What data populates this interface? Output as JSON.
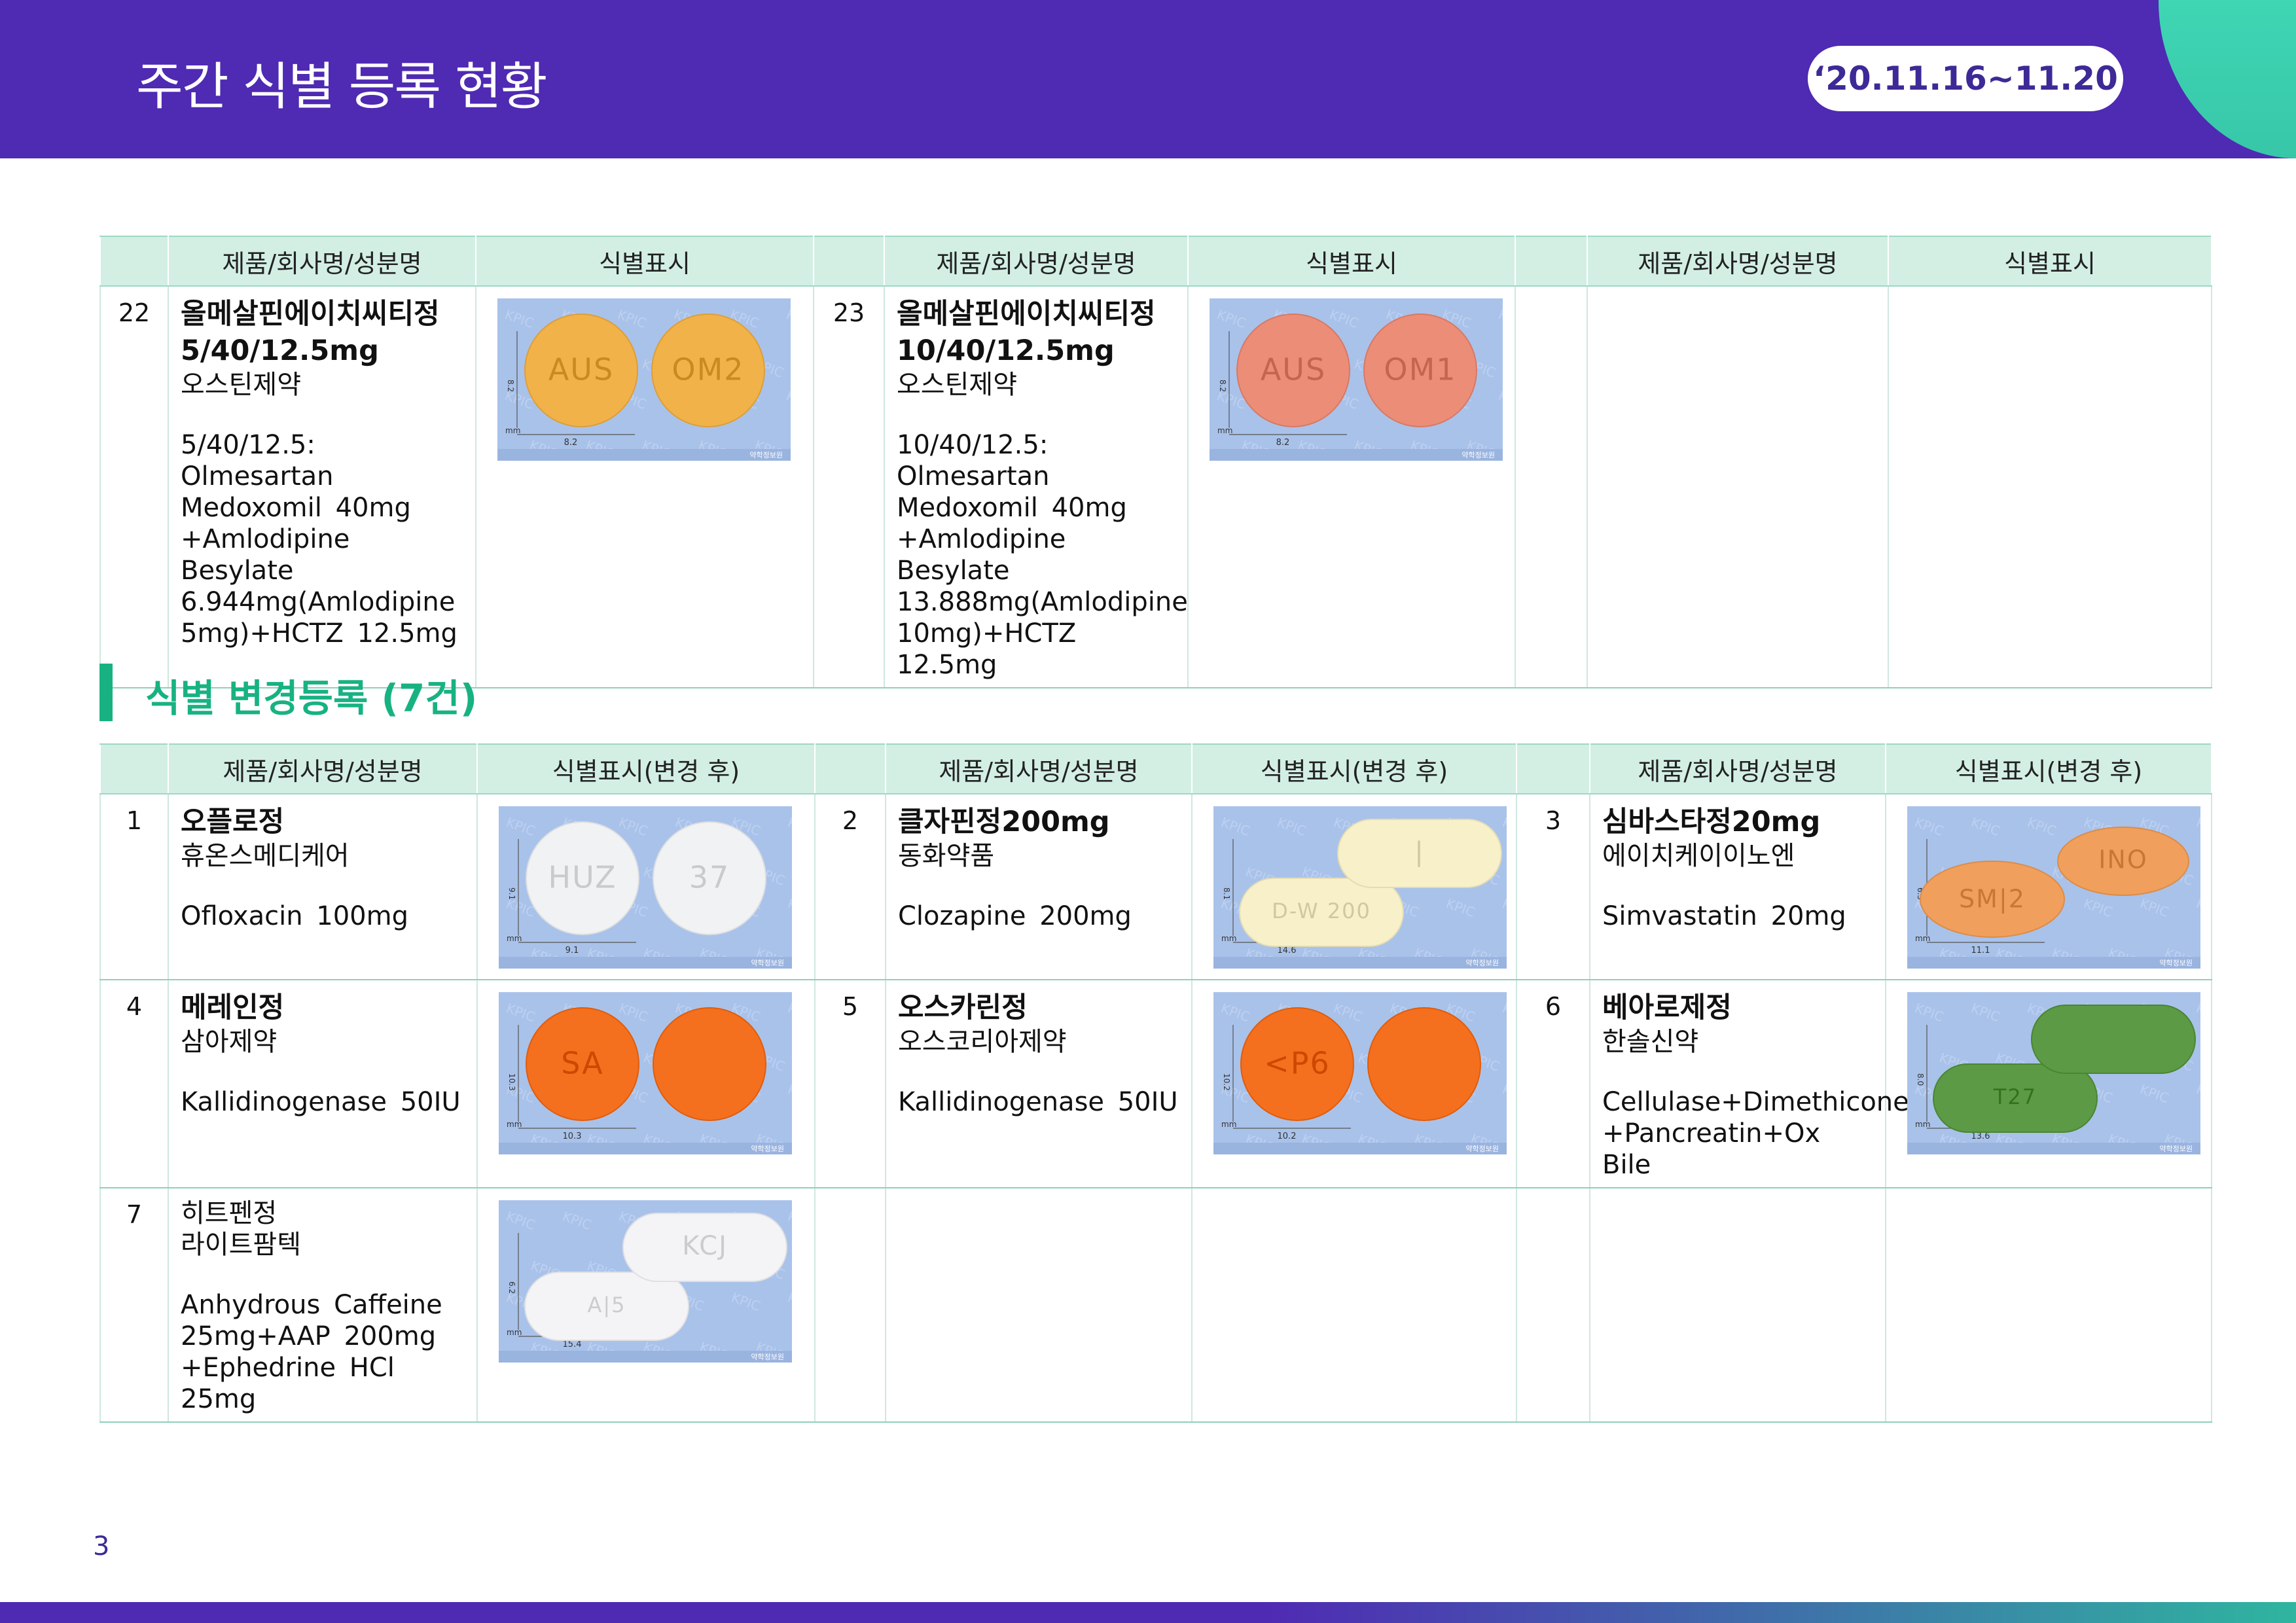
{
  "header": {
    "title": "주간 식별 등록 현황",
    "date": "‘20.11.16~11.20"
  },
  "table1": {
    "headers": [
      "",
      "제품/회사명/성분명",
      "식별표시",
      "",
      "제품/회사명/성분명",
      "식별표시",
      "",
      "제품/회사명/성분명",
      "식별표시"
    ],
    "rows": [
      {
        "num": "22",
        "name": "올메살핀에이치씨티정 5/40/12.5mg",
        "company": "오스틴제약",
        "ingredient": "5/40/12.5: Olmesartan Medoxomil 40mg +Amlodipine Besylate 6.944mg(Amlodipine 5mg)+HCTZ 12.5mg",
        "marks": [
          "AUS",
          "OM2"
        ],
        "size_h": "8.2",
        "size_w": "8.2",
        "color": "#f2b24a"
      },
      {
        "num": "23",
        "name": "올메살핀에이치씨티정 10/40/12.5mg",
        "company": "오스틴제약",
        "ingredient": "10/40/12.5: Olmesartan Medoxomil 40mg +Amlodipine Besylate 13.888mg(Amlodipine 10mg)+HCTZ 12.5mg",
        "marks": [
          "AUS",
          "OM1"
        ],
        "size_h": "8.2",
        "size_w": "8.2",
        "color": "#ec8d78"
      }
    ]
  },
  "section": {
    "title": "식별 변경등록 (7건)"
  },
  "table2": {
    "headers": [
      "",
      "제품/회사명/성분명",
      "식별표시(변경 후)",
      "",
      "제품/회사명/성분명",
      "식별표시(변경 후)",
      "",
      "제품/회사명/성분명",
      "식별표시(변경 후)"
    ],
    "items": [
      {
        "num": "1",
        "name": "오플로정",
        "company": "휴온스메디케어",
        "ingredient": "Ofloxacin 100mg",
        "marks": [
          "HUZ",
          "37"
        ],
        "size_h": "9.1",
        "size_w": "9.1",
        "color": "#f1f2f4"
      },
      {
        "num": "2",
        "name": "클자핀정200mg",
        "company": "동화약품",
        "ingredient": "Clozapine 200mg",
        "marks": [
          "D-W 200",
          "|"
        ],
        "size_h": "8.1",
        "size_w": "14.6",
        "color": "#f7f0c8"
      },
      {
        "num": "3",
        "name": "심바스타정20mg",
        "company": "에이치케이이노엔",
        "ingredient": "Simvastatin 20mg",
        "marks": [
          "SM|2",
          "INO"
        ],
        "size_h": "6.3",
        "size_w": "11.1",
        "color": "#f0a05c"
      },
      {
        "num": "4",
        "name": "메레인정",
        "company": "삼아제약",
        "ingredient": "Kallidinogenase 50IU",
        "marks": [
          "SA",
          ""
        ],
        "size_h": "10.3",
        "size_w": "10.3",
        "color": "#f5701e"
      },
      {
        "num": "5",
        "name": "오스카린정",
        "company": "오스코리아제약",
        "ingredient": "Kallidinogenase 50IU",
        "marks": [
          "<P6",
          ""
        ],
        "size_h": "10.2",
        "size_w": "10.2",
        "color": "#f5701e"
      },
      {
        "num": "6",
        "name": "베아로제정",
        "company": "한솔신약",
        "ingredient": "Cellulase+Dimethicone +Pancreatin+Ox Bile",
        "marks": [
          "T27",
          ""
        ],
        "size_h": "8.0",
        "size_w": "13.6",
        "color": "#5d9a45"
      },
      {
        "num": "7",
        "name": "히트펜정",
        "company": "라이트팜텍",
        "ingredient": "Anhydrous Caffeine 25mg+AAP 200mg +Ephedrine HCl 25mg",
        "marks": [
          "A|5",
          "KCJ"
        ],
        "size_h": "6.2",
        "size_w": "15.4",
        "color": "#f4f4f6"
      }
    ]
  },
  "image_watermark": "KPIC",
  "image_unit": "mm",
  "image_credit": "약학정보원",
  "page_number": "3"
}
